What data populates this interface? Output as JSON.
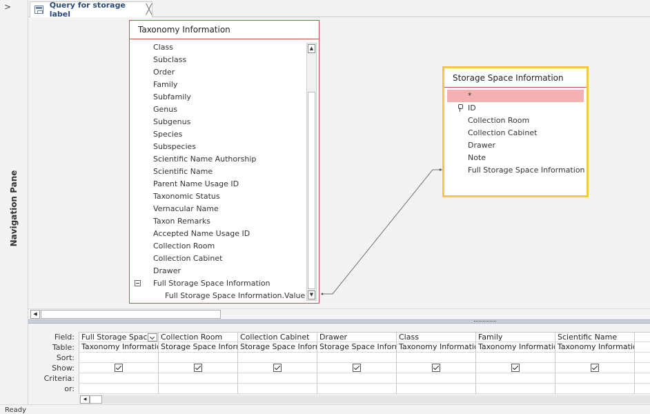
{
  "nav_pane": {
    "toggle": ">",
    "label": "Navigation Pane"
  },
  "tab": {
    "title": "Query for storage label",
    "close": "╳"
  },
  "taxonomy_table": {
    "title": "Taxonomy Information",
    "fields": [
      "Class",
      "Subclass",
      "Order",
      "Family",
      "Subfamily",
      "Genus",
      "Subgenus",
      "Species",
      "Subspecies",
      "Scientific Name Authorship",
      "Scientific Name",
      "Parent Name Usage ID",
      "Taxonomic Status",
      "Vernacular Name",
      "Taxon Remarks",
      "Accepted Name Usage ID",
      "Collection Room",
      "Collection Cabinet",
      "Drawer",
      "Full Storage Space Information",
      "Full Storage Space Information.Value"
    ],
    "scroll_up": "▲",
    "scroll_down": "▼"
  },
  "storage_table": {
    "title": "Storage Space Information",
    "fields": [
      "*",
      "ID",
      "Collection Room",
      "Collection Cabinet",
      "Drawer",
      "Note",
      "Full Storage Space Information"
    ]
  },
  "scroll": {
    "left": "◀"
  },
  "qbe": {
    "row_labels": [
      "Field:",
      "Table:",
      "Sort:",
      "Show:",
      "Criteria:",
      "or:"
    ],
    "columns": [
      {
        "field": "Full Storage Space",
        "table": "Taxonomy Informatio",
        "show": true
      },
      {
        "field": "Collection Room",
        "table": "Storage Space Inform",
        "show": true
      },
      {
        "field": "Collection Cabinet",
        "table": "Storage Space Inform",
        "show": true
      },
      {
        "field": "Drawer",
        "table": "Storage Space Inform",
        "show": true
      },
      {
        "field": "Class",
        "table": "Taxonomy Informatio",
        "show": true
      },
      {
        "field": "Family",
        "table": "Taxonomy Informatio",
        "show": true
      },
      {
        "field": "Scientific Name",
        "table": "Taxonomy Informatio",
        "show": true
      }
    ]
  },
  "status": {
    "text": "Ready"
  }
}
